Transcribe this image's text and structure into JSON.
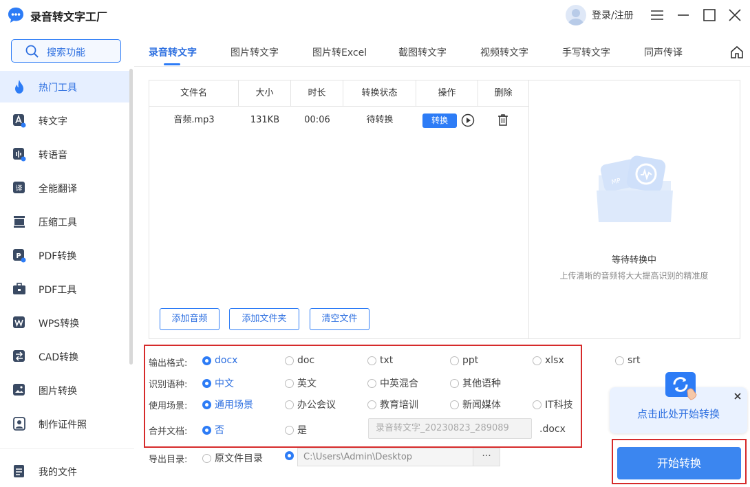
{
  "app": {
    "title": "录音转文字工厂",
    "login": "登录/注册",
    "accent": "#2d7cf6",
    "alert": "#d62a2a"
  },
  "sidebar": {
    "search_label": "搜索功能",
    "items": [
      {
        "label": "热门工具",
        "icon": "fire-icon",
        "active": true
      },
      {
        "label": "转文字",
        "icon": "text-convert-icon"
      },
      {
        "label": "转语音",
        "icon": "voice-icon"
      },
      {
        "label": "全能翻译",
        "icon": "translate-icon"
      },
      {
        "label": "压缩工具",
        "icon": "compress-icon"
      },
      {
        "label": "PDF转换",
        "icon": "pdf-convert-icon"
      },
      {
        "label": "PDF工具",
        "icon": "toolbox-icon"
      },
      {
        "label": "WPS转换",
        "icon": "wps-icon"
      },
      {
        "label": "CAD转换",
        "icon": "cad-icon"
      },
      {
        "label": "图片转换",
        "icon": "image-icon"
      },
      {
        "label": "制作证件照",
        "icon": "id-photo-icon"
      }
    ],
    "bottom_item": {
      "label": "我的文件",
      "icon": "document-icon"
    }
  },
  "tabs": [
    "录音转文字",
    "图片转文字",
    "图片转Excel",
    "截图转文字",
    "视频转文字",
    "手写转文字",
    "同声传译"
  ],
  "table": {
    "headers": [
      "文件名",
      "大小",
      "时长",
      "转换状态",
      "操作",
      "删除"
    ],
    "rows": [
      {
        "name": "音频.mp3",
        "size": "131KB",
        "duration": "00:06",
        "status": "待转换",
        "action": "转换"
      }
    ]
  },
  "panel_buttons": {
    "add_audio": "添加音频",
    "add_folder": "添加文件夹",
    "clear": "清空文件"
  },
  "right_panel": {
    "title": "等待转换中",
    "subtitle": "上传清晰的音频将大大提高识别的精准度"
  },
  "options": {
    "format_label": "输出格式:",
    "formats": [
      "docx",
      "doc",
      "txt",
      "ppt",
      "xlsx",
      "srt"
    ],
    "format_selected": "docx",
    "language_label": "识别语种:",
    "languages": [
      "中文",
      "英文",
      "中英混合",
      "其他语种"
    ],
    "language_selected": "中文",
    "scene_label": "使用场景:",
    "scenes": [
      "通用场景",
      "办公会议",
      "教育培训",
      "新闻媒体",
      "IT科技"
    ],
    "scene_selected": "通用场景",
    "merge_label": "合并文档:",
    "merge_options": [
      "否",
      "是"
    ],
    "merge_selected": "否",
    "merge_filename": "录音转文字_20230823_289089",
    "merge_ext": ".docx",
    "export_label": "导出目录:",
    "export_original": "原文件目录",
    "export_path": "C:\\Users\\Admin\\Desktop",
    "export_more": "···"
  },
  "tooltip": {
    "text": "点击此处开始转换"
  },
  "start_button": {
    "label": "开始转换"
  }
}
